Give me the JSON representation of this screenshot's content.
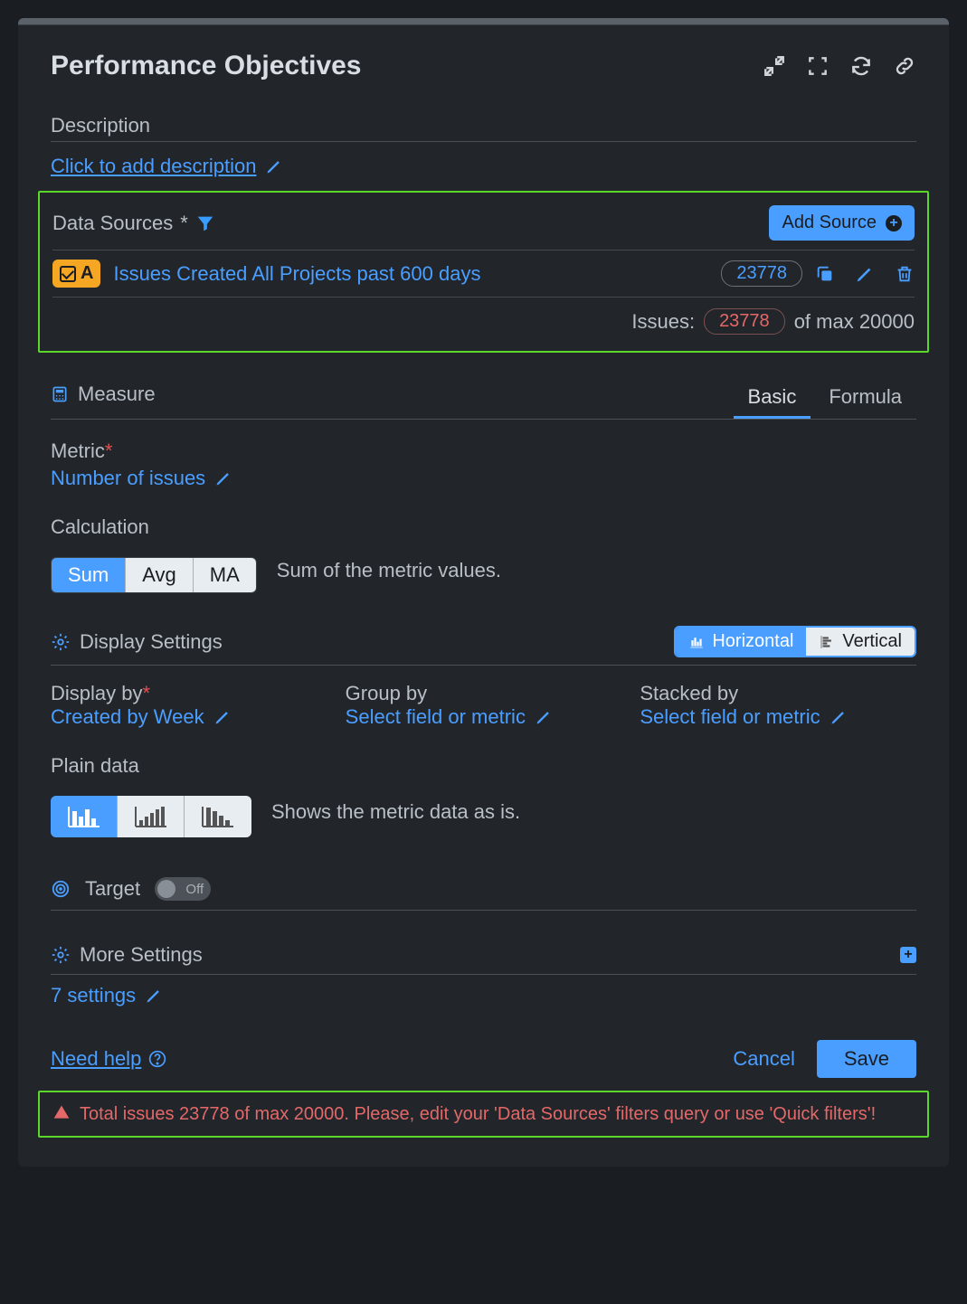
{
  "header": {
    "title": "Performance Objectives"
  },
  "description": {
    "label": "Description",
    "placeholder": "Click to add description"
  },
  "dataSources": {
    "label": "Data Sources",
    "addButton": "Add Source",
    "source": {
      "letter": "A",
      "name": "Issues Created All Projects past 600 days",
      "count": "23778"
    },
    "totalLabel": "Issues:",
    "totalCount": "23778",
    "totalSuffix": "of max 20000"
  },
  "measure": {
    "label": "Measure",
    "tabs": {
      "basic": "Basic",
      "formula": "Formula"
    }
  },
  "metric": {
    "label": "Metric",
    "value": "Number of issues"
  },
  "calculation": {
    "label": "Calculation",
    "buttons": {
      "sum": "Sum",
      "avg": "Avg",
      "ma": "MA"
    },
    "description": "Sum of the metric values."
  },
  "displaySettings": {
    "label": "Display Settings",
    "orientation": {
      "horizontal": "Horizontal",
      "vertical": "Vertical"
    },
    "displayBy": {
      "label": "Display by",
      "value": "Created by Week"
    },
    "groupBy": {
      "label": "Group by",
      "value": "Select field or metric"
    },
    "stackedBy": {
      "label": "Stacked by",
      "value": "Select field or metric"
    },
    "plainData": {
      "label": "Plain data",
      "description": "Shows the metric data as is."
    }
  },
  "target": {
    "label": "Target",
    "state": "Off"
  },
  "moreSettings": {
    "label": "More Settings",
    "count": "7 settings"
  },
  "help": {
    "label": "Need help"
  },
  "footer": {
    "cancel": "Cancel",
    "save": "Save"
  },
  "error": {
    "message": "Total issues 23778 of max 20000. Please, edit your 'Data Sources' filters query or use 'Quick filters'!"
  }
}
